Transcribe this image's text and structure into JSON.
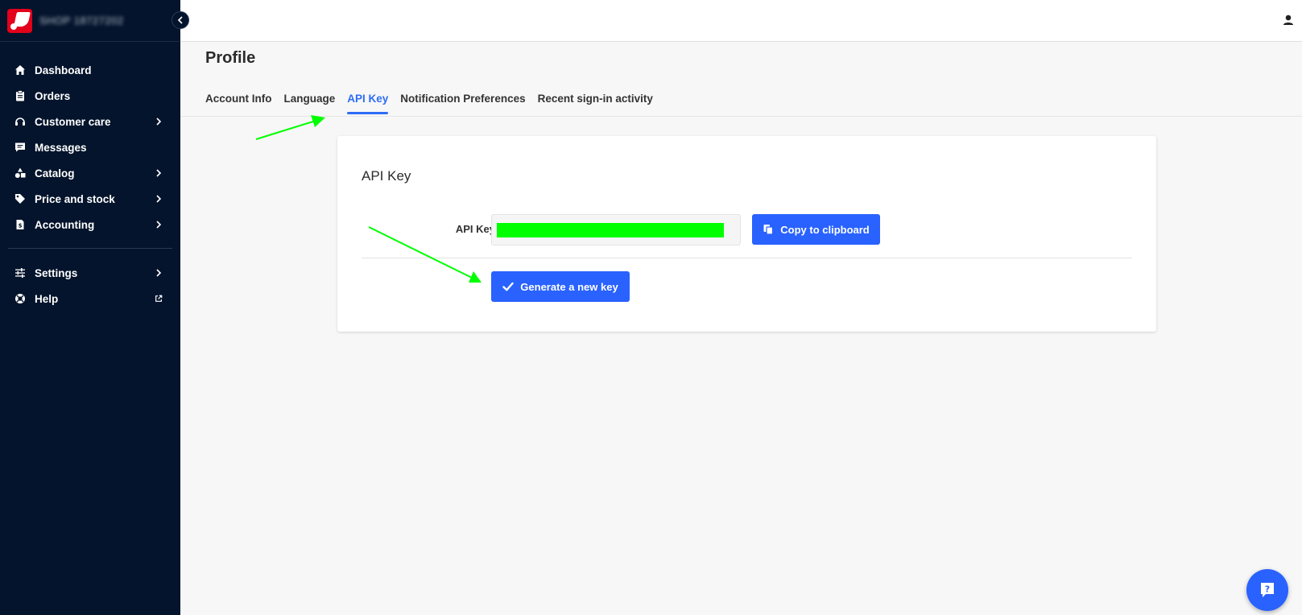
{
  "brand": {
    "shop_name": "SHOP 18727202"
  },
  "sidebar": {
    "items": [
      {
        "label": "Dashboard",
        "icon": "home-icon",
        "chevron": false
      },
      {
        "label": "Orders",
        "icon": "clipboard-icon",
        "chevron": false
      },
      {
        "label": "Customer care",
        "icon": "headset-icon",
        "chevron": true
      },
      {
        "label": "Messages",
        "icon": "chat-icon",
        "chevron": false
      },
      {
        "label": "Catalog",
        "icon": "shapes-icon",
        "chevron": true
      },
      {
        "label": "Price and stock",
        "icon": "tag-icon",
        "chevron": true
      },
      {
        "label": "Accounting",
        "icon": "document-icon",
        "chevron": true
      }
    ],
    "bottom_items": [
      {
        "label": "Settings",
        "icon": "sliders-icon",
        "chevron": true
      },
      {
        "label": "Help",
        "icon": "lifebuoy-icon",
        "external": true
      }
    ]
  },
  "page": {
    "title": "Profile"
  },
  "tabs": [
    {
      "label": "Account Info",
      "active": false
    },
    {
      "label": "Language",
      "active": false
    },
    {
      "label": "API Key",
      "active": true
    },
    {
      "label": "Notification Preferences",
      "active": false
    },
    {
      "label": "Recent sign-in activity",
      "active": false
    }
  ],
  "card": {
    "title": "API Key",
    "field_label": "API Key",
    "api_key_value": "",
    "copy_label": "Copy to clipboard",
    "generate_label": "Generate a new key"
  },
  "colors": {
    "sidebar_bg": "#04142c",
    "accent": "#2962ff",
    "active_tab": "#2d6cf6",
    "annotation_arrow": "#00ff00",
    "redaction": "#00ff00"
  }
}
